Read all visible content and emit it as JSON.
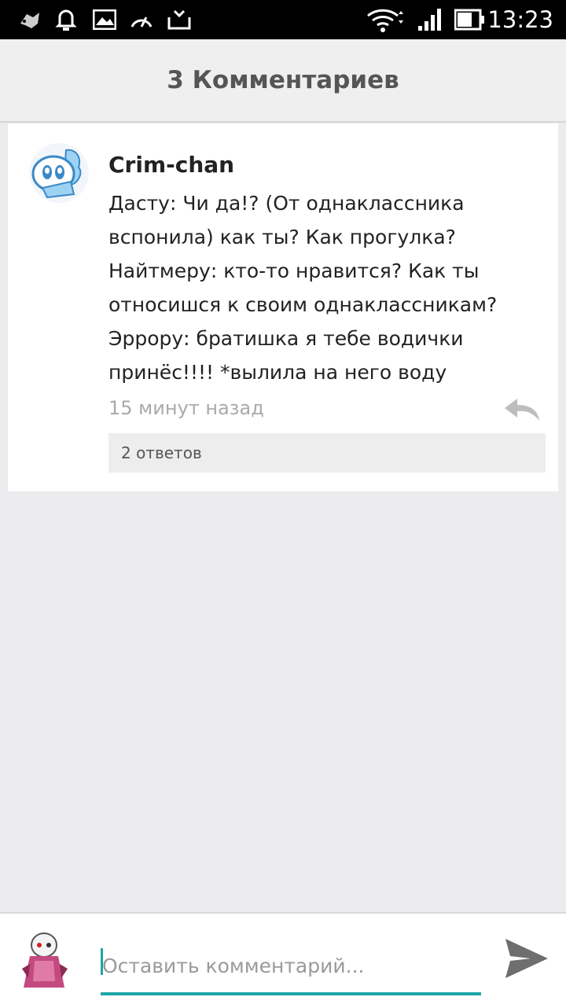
{
  "status_bar": {
    "time": "13:23",
    "icons": [
      "gamepad-icon",
      "bell-icon",
      "image-icon",
      "speedometer-icon",
      "antenna-icon",
      "wifi-icon",
      "signal-icon",
      "battery-icon"
    ]
  },
  "header": {
    "title": "3 Комментариев"
  },
  "comment": {
    "author": "Crim-chan",
    "text": "Дасту: Чи да!? (От однаклассника\nвспонила) как ты? Как прогулка?\nНайтмеру: кто-то нравится? Как ты\nотносишся к своим однаклассникам?\nЭррору: братишка я тебе водички\nпринёс!!!! *вылила на него воду",
    "time": "15 минут назад",
    "replies_label": "2 ответов"
  },
  "composer": {
    "placeholder": "Оставить комментарий...",
    "value": ""
  },
  "colors": {
    "accent": "#1FA5A5",
    "background": "#ECEBEE",
    "card": "#FFFFFF"
  }
}
